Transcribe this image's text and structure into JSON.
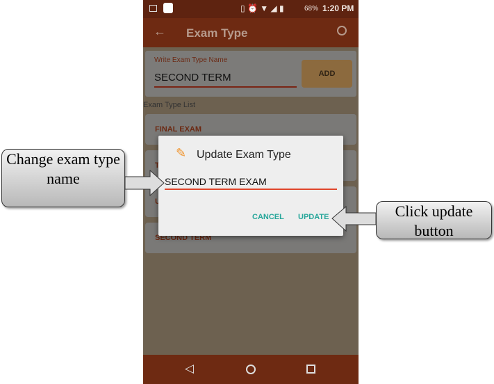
{
  "status_bar": {
    "battery": "68%",
    "time": "1:20 PM"
  },
  "app_bar": {
    "title": "Exam Type",
    "back_icon": "arrow-left-icon",
    "search_icon": "search-icon"
  },
  "form": {
    "label": "Write Exam Type Name",
    "value": "SECOND TERM",
    "add_label": "ADD"
  },
  "list": {
    "heading": "Exam Type List",
    "items": [
      "FINAL EXAM",
      "T",
      "U",
      "SECOND TERM"
    ]
  },
  "dialog": {
    "title": "Update Exam Type",
    "icon": "pencil-icon",
    "value": "SECOND TERM EXAM",
    "cancel": "CANCEL",
    "update": "UPDATE",
    "accent": "#26a69a",
    "underline": "#e0452b"
  },
  "callouts": {
    "left": "Change exam type name",
    "right": "Click update button"
  }
}
